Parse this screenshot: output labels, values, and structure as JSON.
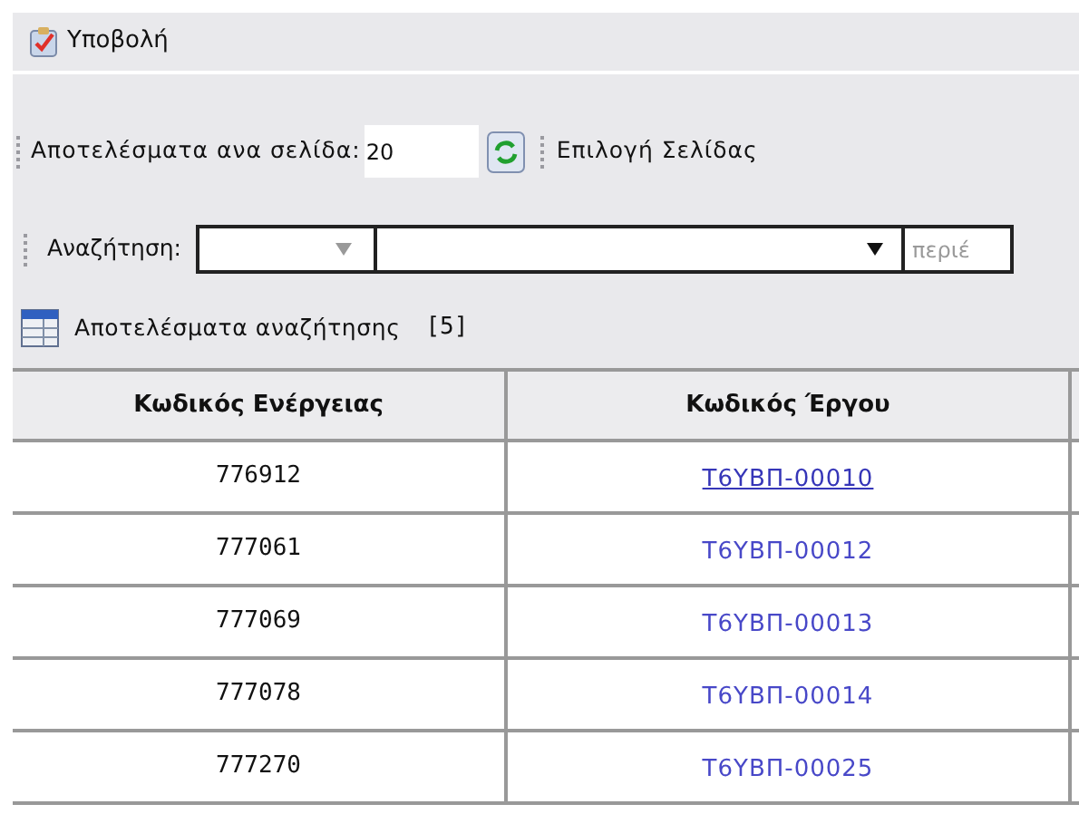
{
  "toolbar": {
    "submit_button": "Υποβολή"
  },
  "paging": {
    "label": "Αποτελέσματα ανα σελίδα:",
    "value": "20",
    "page_select_label": "Επιλογή Σελίδας"
  },
  "search": {
    "label": "Αναζήτηση:",
    "field_3_placeholder": "περιέ"
  },
  "results": {
    "title": "Αποτελέσματα αναζήτησης",
    "count": "[5]"
  },
  "table": {
    "columns": [
      "Κωδικός Ενέργειας",
      "Κωδικός Έργου"
    ],
    "rows": [
      {
        "action_code": "776912",
        "project_code": "Τ6ΥΒΠ-00010",
        "visited": true
      },
      {
        "action_code": "777061",
        "project_code": "Τ6ΥΒΠ-00012",
        "visited": false
      },
      {
        "action_code": "777069",
        "project_code": "Τ6ΥΒΠ-00013",
        "visited": false
      },
      {
        "action_code": "777078",
        "project_code": "Τ6ΥΒΠ-00014",
        "visited": false
      },
      {
        "action_code": "777270",
        "project_code": "Τ6ΥΒΠ-00025",
        "visited": false
      }
    ]
  }
}
